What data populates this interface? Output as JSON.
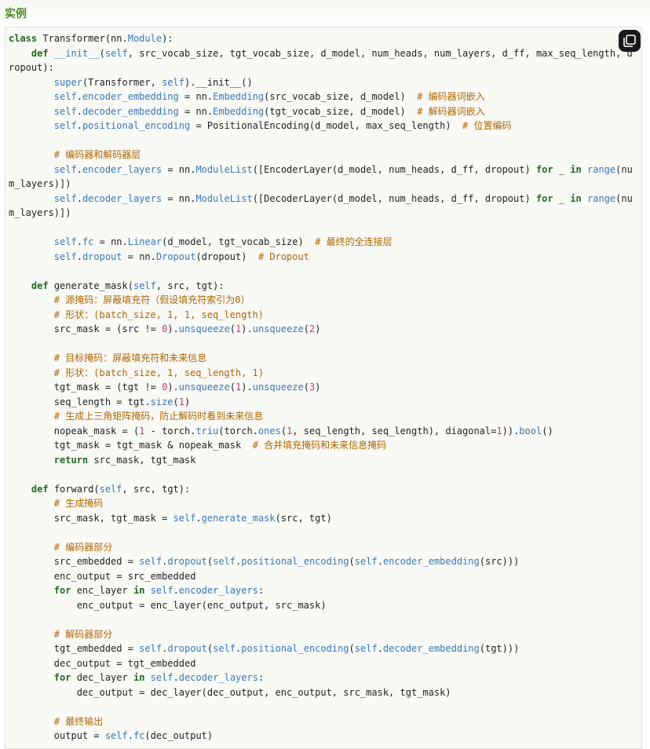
{
  "header": {
    "title": "实例"
  },
  "code_lines": [
    "class Transformer(nn.Module):",
    "    def __init__(self, src_vocab_size, tgt_vocab_size, d_model, num_heads, num_layers, d_ff, max_seq_length, d",
    "ropout):",
    "        super(Transformer, self).__init__()",
    "        self.encoder_embedding = nn.Embedding(src_vocab_size, d_model)  # 编码器词嵌入",
    "        self.decoder_embedding = nn.Embedding(tgt_vocab_size, d_model)  # 解码器词嵌入",
    "        self.positional_encoding = PositionalEncoding(d_model, max_seq_length)  # 位置编码",
    "",
    "        # 编码器和解码器层",
    "        self.encoder_layers = nn.ModuleList([EncoderLayer(d_model, num_heads, d_ff, dropout) for _ in range(nu",
    "m_layers)])",
    "        self.decoder_layers = nn.ModuleList([DecoderLayer(d_model, num_heads, d_ff, dropout) for _ in range(nu",
    "m_layers)])",
    "",
    "        self.fc = nn.Linear(d_model, tgt_vocab_size)  # 最终的全连接层",
    "        self.dropout = nn.Dropout(dropout)  # Dropout",
    "",
    "    def generate_mask(self, src, tgt):",
    "        # 源掩码：屏蔽填充符（假设填充符索引为0）",
    "        # 形状：(batch_size, 1, 1, seq_length)",
    "        src_mask = (src != 0).unsqueeze(1).unsqueeze(2)",
    "",
    "        # 目标掩码：屏蔽填充符和未来信息",
    "        # 形状：(batch_size, 1, seq_length, 1)",
    "        tgt_mask = (tgt != 0).unsqueeze(1).unsqueeze(3)",
    "        seq_length = tgt.size(1)",
    "        # 生成上三角矩阵掩码，防止解码时看到未来信息",
    "        nopeak_mask = (1 - torch.triu(torch.ones(1, seq_length, seq_length), diagonal=1)).bool()",
    "        tgt_mask = tgt_mask & nopeak_mask  # 合并填充掩码和未来信息掩码",
    "        return src_mask, tgt_mask",
    "",
    "    def forward(self, src, tgt):",
    "        # 生成掩码",
    "        src_mask, tgt_mask = self.generate_mask(src, tgt)",
    "",
    "        # 编码器部分",
    "        src_embedded = self.dropout(self.positional_encoding(self.encoder_embedding(src)))",
    "        enc_output = src_embedded",
    "        for enc_layer in self.encoder_layers:",
    "            enc_output = enc_layer(enc_output, src_mask)",
    "",
    "        # 解码器部分",
    "        tgt_embedded = self.dropout(self.positional_encoding(self.decoder_embedding(tgt)))",
    "        dec_output = tgt_embedded",
    "        for dec_layer in self.decoder_layers:",
    "            dec_output = dec_layer(dec_output, enc_output, src_mask, tgt_mask)",
    "",
    "        # 最终输出",
    "        output = self.fc(dec_output)"
  ],
  "colors": {
    "keyword": "#1d6b1d",
    "self": "#3478b8",
    "comment": "#b06600",
    "number": "#c33a76",
    "header_title": "#4c8a1c"
  },
  "icons": {
    "copy": "copy-icon"
  }
}
